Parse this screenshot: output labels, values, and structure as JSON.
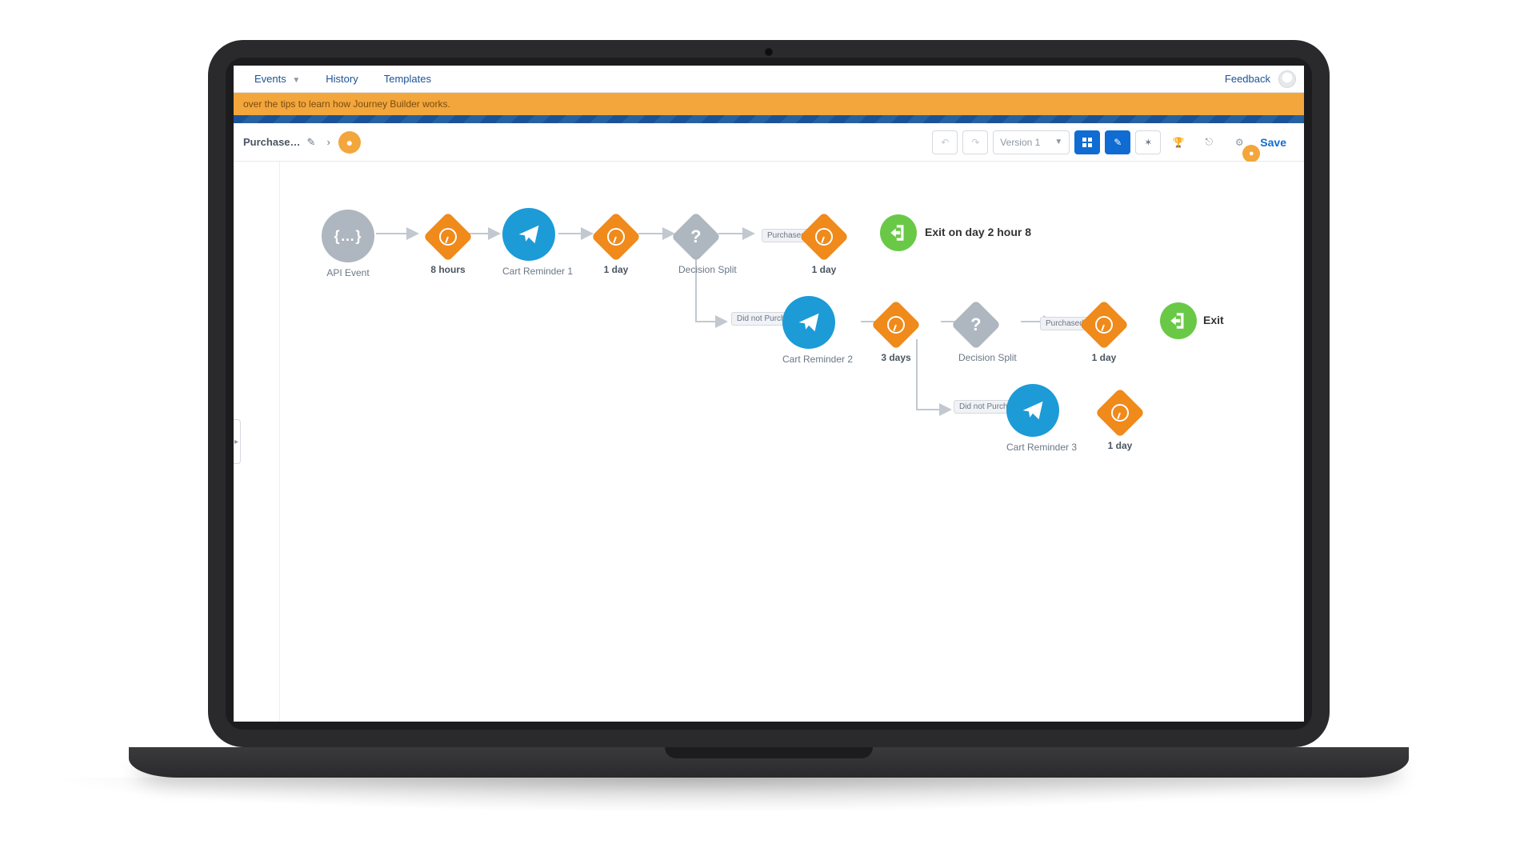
{
  "nav": {
    "events": "Events",
    "history": "History",
    "templates": "Templates",
    "feedback": "Feedback"
  },
  "tipbar": "over the tips to learn how Journey Builder works.",
  "header": {
    "title": "Purchase…",
    "version": "Version 1",
    "save": "Save"
  },
  "nodes": {
    "api_event": "API Event",
    "wait_8h": "8 hours",
    "cart1": "Cart Reminder 1",
    "wait_1d_a": "1 day",
    "split1": "Decision Split",
    "path_purchased": "Purchased",
    "wait_1d_b": "1 day",
    "exit1": "Exit on day 2 hour 8",
    "path_didnot1": "Did not Purchase",
    "cart2": "Cart Reminder 2",
    "wait_3d": "3 days",
    "split2": "Decision Split",
    "path_purchased2": "Purchased",
    "wait_1d_c": "1 day",
    "exit2": "Exit",
    "path_didnot2": "Did not Purchase",
    "cart3": "Cart Reminder 3",
    "wait_1d_d": "1 day"
  }
}
